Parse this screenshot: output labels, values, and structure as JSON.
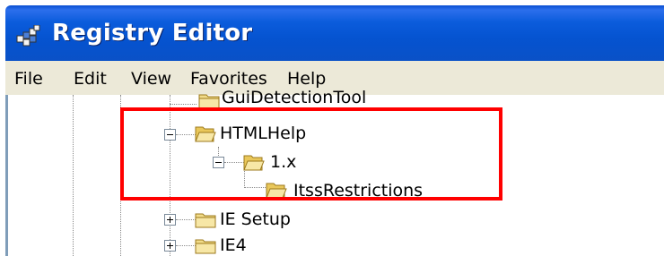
{
  "window": {
    "title": "Registry Editor",
    "title_color": "#0553d0"
  },
  "menu": {
    "items": [
      "File",
      "Edit",
      "View",
      "Favorites",
      "Help"
    ]
  },
  "tree": {
    "nodes": [
      {
        "label": "GuiDetectionTool",
        "expanded": null
      },
      {
        "label": "HTMLHelp",
        "expanded": true
      },
      {
        "label": "1.x",
        "expanded": true
      },
      {
        "label": "ItssRestrictions",
        "expanded": null
      },
      {
        "label": "IE Setup",
        "expanded": false
      },
      {
        "label": "IE4",
        "expanded": false
      }
    ]
  },
  "annotation": {
    "color": "#ff0000"
  }
}
